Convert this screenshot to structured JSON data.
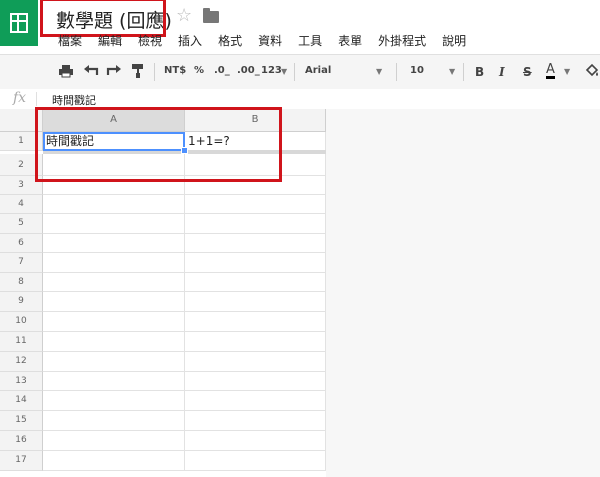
{
  "header": {
    "app_icon": "sheets-logo-icon",
    "doc_title": "數學題 (回應)",
    "star_icon": "star-icon",
    "folder_icon": "folder-icon"
  },
  "menu": [
    "檔案",
    "編輯",
    "檢視",
    "插入",
    "格式",
    "資料",
    "工具",
    "表單",
    "外掛程式",
    "說明"
  ],
  "toolbar": {
    "currency": "NT$",
    "percent": "%",
    "dec_decrease": ".0_",
    "dec_increase": ".00_",
    "more_formats": "123",
    "font": "Arial",
    "font_size": "10",
    "bold": "B",
    "italic": "I",
    "strike": "S",
    "text_color": "A",
    "accent_color": "#0f9d58",
    "highlight_color": "#d0141b",
    "selection_color": "#4d90fe"
  },
  "formula_bar": {
    "fx_label": "fx",
    "content": "時間戳記"
  },
  "columns": [
    "A",
    "B"
  ],
  "rows": [
    "1",
    "2",
    "3",
    "4",
    "5",
    "6",
    "7",
    "8",
    "9",
    "10",
    "11",
    "12",
    "13",
    "14",
    "15",
    "16",
    "17"
  ],
  "cells": {
    "A1": "時間戳記",
    "B1": "1+1=?"
  },
  "selected_cell": "A1"
}
